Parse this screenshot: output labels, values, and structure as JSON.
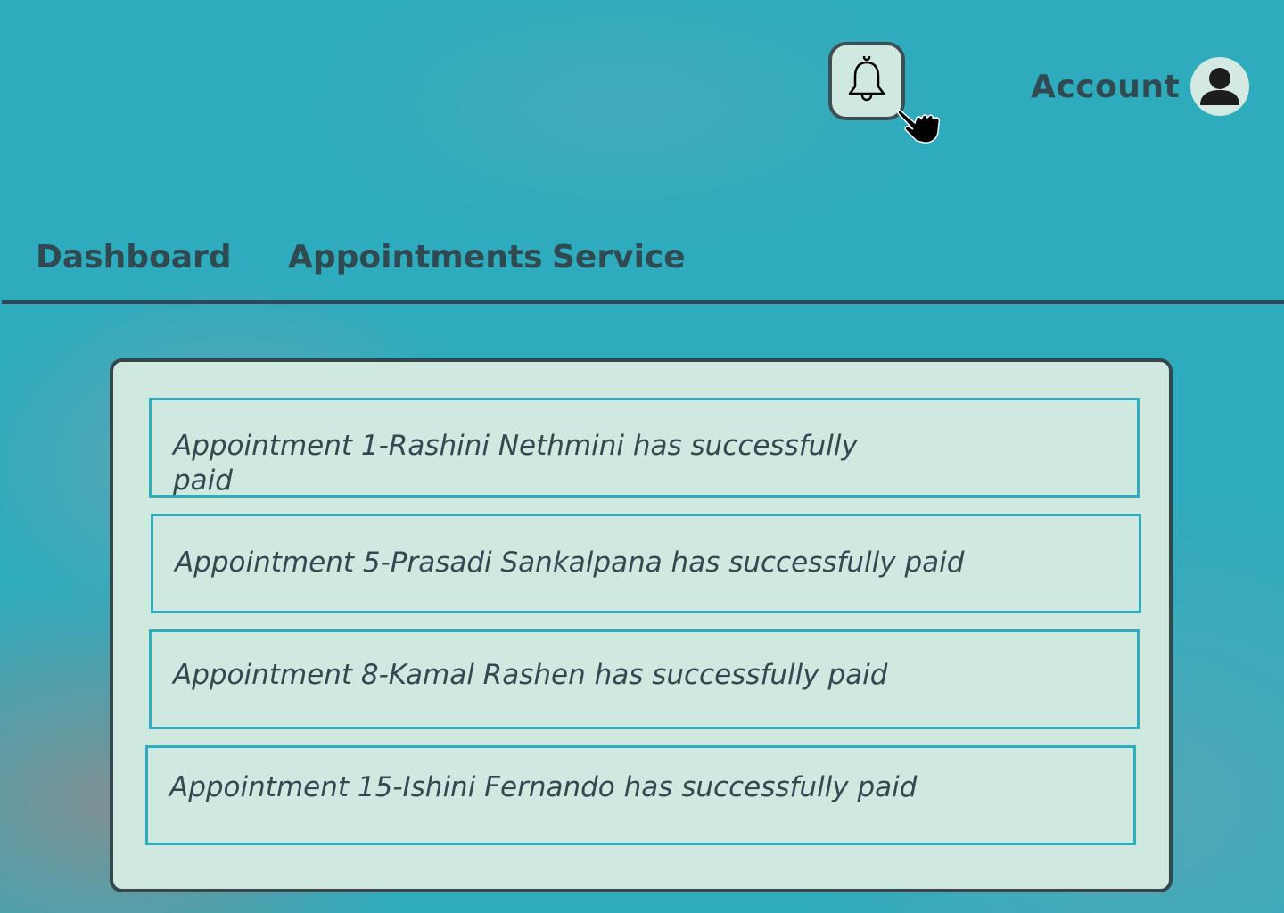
{
  "header": {
    "notifications_icon": "bell-icon",
    "cursor_icon": "hand-pointer-icon",
    "account_label": "Account",
    "account_icon": "user-avatar-icon"
  },
  "nav": {
    "items": [
      {
        "label": "Dashboard"
      },
      {
        "label": "Appointments"
      },
      {
        "label": "Service"
      }
    ]
  },
  "notifications": [
    {
      "text": "Appointment 1-Rashini Nethmini has successfully paid"
    },
    {
      "text": "Appointment 5-Prasadi Sankalpana has successfully paid"
    },
    {
      "text": "Appointment 8-Kamal Rashen has successfully paid"
    },
    {
      "text": "Appointment 15-Ishini Fernando has successfully paid"
    }
  ],
  "colors": {
    "background": "#2eabbd",
    "panel": "#cfe8e0",
    "border_dark": "#34474c",
    "item_border": "#2eabbd",
    "text": "#2f4a50"
  }
}
